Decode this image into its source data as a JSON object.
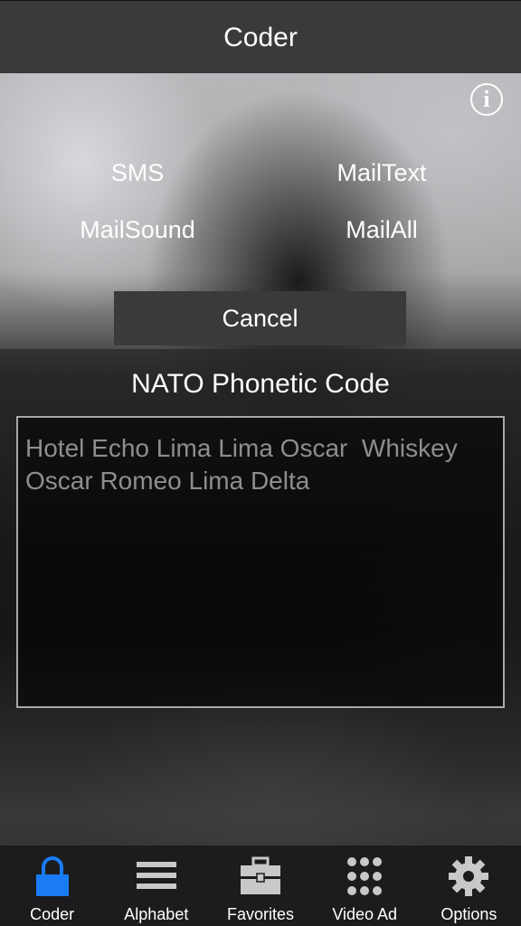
{
  "header": {
    "title": "Coder"
  },
  "share_actions": {
    "sms": "SMS",
    "mail_text": "MailText",
    "mail_sound": "MailSound",
    "mail_all": "MailAll",
    "cancel": "Cancel"
  },
  "info_glyph": "i",
  "section": {
    "title": "NATO Phonetic Code"
  },
  "output": {
    "text": "Hotel Echo Lima Lima Oscar  Whiskey\nOscar Romeo Lima Delta"
  },
  "tabs": [
    {
      "label": "Coder",
      "icon": "lock-icon",
      "active": true
    },
    {
      "label": "Alphabet",
      "icon": "list-icon",
      "active": false
    },
    {
      "label": "Favorites",
      "icon": "briefcase-icon",
      "active": false
    },
    {
      "label": "Video Ad",
      "icon": "grid-icon",
      "active": false
    },
    {
      "label": "Options",
      "icon": "gear-icon",
      "active": false
    }
  ],
  "colors": {
    "accent": "#1a7cf5",
    "tab_icon": "#c8c8c8",
    "topbar": "#3a3a3c"
  }
}
